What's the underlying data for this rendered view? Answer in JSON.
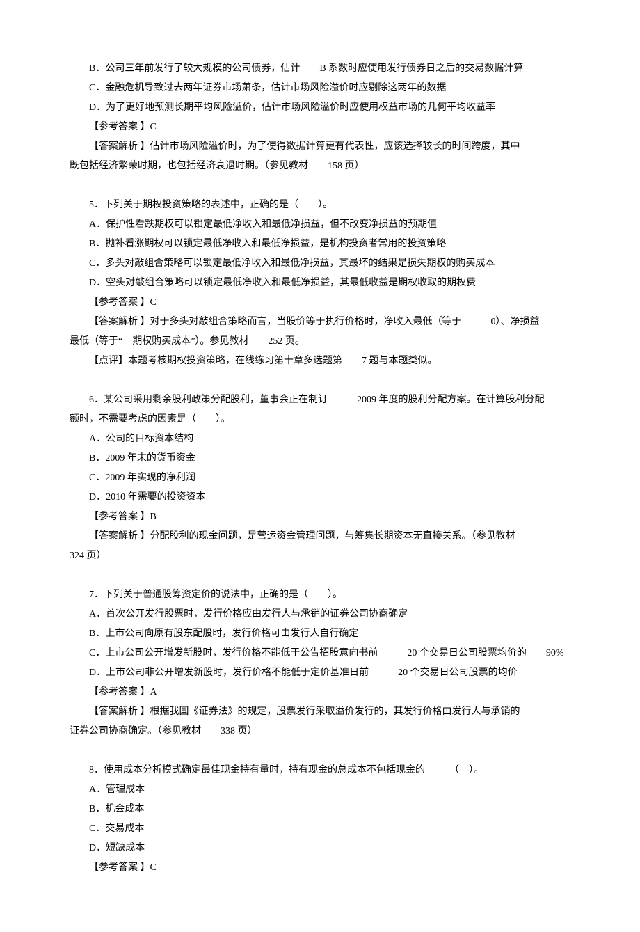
{
  "block1": {
    "lines": [
      "B．公司三年前发行了较大规模的公司债券，估计　　B 系数时应使用发行债券日之后的交易数据计算",
      "C．金融危机导致过去两年证券市场萧条，估计市场风险溢价时应剔除这两年的数据",
      "D．为了更好地预测长期平均风险溢价，估计市场风险溢价时应使用权益市场的几何平均收益率",
      "【参考答案 】C",
      "【答案解析 】估计市场风险溢价时，为了使得数据计算更有代表性，应该选择较长的时间跨度，其中"
    ],
    "tail": "既包括经济繁荣时期，也包括经济衰退时期。（参见教材　　158 页）"
  },
  "q5": {
    "stem": "5．下列关于期权投资策略的表述中，正确的是（　　）。",
    "A": "A．保护性看跌期权可以锁定最低净收入和最低净损益，但不改变净损益的预期值",
    "B": "B．抛补看涨期权可以锁定最低净收入和最低净损益，是机构投资者常用的投资策略",
    "C": "C．多头对敲组合策略可以锁定最低净收入和最低净损益，其最坏的结果是损失期权的购买成本",
    "D": "D．空头对敲组合策略可以锁定最低净收入和最低净损益，其最低收益是期权收取的期权费",
    "ans": "【参考答案 】C",
    "exp1": "【答案解析 】对于多头对敲组合策略而言，当股价等于执行价格时，净收入最低（等于　　　0）、净损益",
    "exp1tail": "最低（等于“－期权购买成本”）。参见教材　　252 页。",
    "exp2": "【点评】本题考核期权投资策略，在线练习第十章多选题第　　7 题与本题类似。"
  },
  "q6": {
    "stem": "6．某公司采用剩余股利政策分配股利，董事会正在制订　　　2009 年度的股利分配方案。在计算股利分配",
    "stemtail": "额时，不需要考虑的因素是（　　）。",
    "A": "A．公司的目标资本结构",
    "B": "B．2009 年末的货币资金",
    "C": "C．2009 年实现的净利润",
    "D": "D．2010 年需要的投资资本",
    "ans": "【参考答案 】B",
    "exp": "【答案解析 】分配股利的现金问题，是营运资金管理问题，与筹集长期资本无直接关系。（参见教材",
    "exptail": "324 页）"
  },
  "q7": {
    "stem": "7．下列关于普通股筹资定价的说法中，正确的是（　　）。",
    "A": "A．首次公开发行股票时，发行价格应由发行人与承销的证券公司协商确定",
    "B": "B．上市公司向原有股东配股时，发行价格可由发行人自行确定",
    "C": "C．上市公司公开增发新股时，发行价格不能低于公告招股意向书前　　　20 个交易日公司股票均价的　　90%",
    "D": "D．上市公司非公开增发新股时，发行价格不能低于定价基准日前　　　20 个交易日公司股票的均价",
    "ans": "【参考答案 】A",
    "exp": "【答案解析 】根据我国《证券法》的规定，股票发行采取溢价发行的，其发行价格由发行人与承销的",
    "exptail": "证券公司协商确定。（参见教材　　338 页）"
  },
  "q8": {
    "stem": "8．使用成本分析模式确定最佳现金持有量时，持有现金的总成本不包括现金的　　　（　）。",
    "A": "A．管理成本",
    "B": "B．机会成本",
    "C": "C．交易成本",
    "D": "D．短缺成本",
    "ans": "【参考答案 】C"
  }
}
